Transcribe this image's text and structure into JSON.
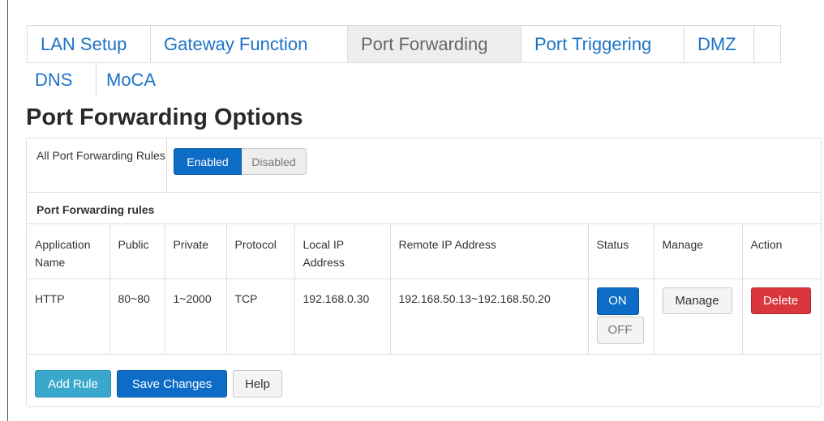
{
  "tabs": {
    "row1": [
      "LAN Setup",
      "Gateway Function",
      "Port Forwarding",
      "Port Triggering",
      "DMZ"
    ],
    "row2": [
      "DNS",
      "MoCA"
    ],
    "active": "Port Forwarding"
  },
  "page_title": "Port Forwarding Options",
  "options": {
    "all_rules_label": "All Port Forwarding Rules",
    "enabled_label": "Enabled",
    "disabled_label": "Disabled",
    "selected": "Enabled"
  },
  "rules_section": {
    "title": "Port Forwarding rules",
    "columns": [
      "Application Name",
      "Public",
      "Private",
      "Protocol",
      "Local IP Address",
      "Remote IP Address",
      "Status",
      "Manage",
      "Action"
    ],
    "rows": [
      {
        "application_name": "HTTP",
        "public": "80~80",
        "private": "1~2000",
        "protocol": "TCP",
        "local_ip": "192.168.0.30",
        "remote_ip": "192.168.50.13~192.168.50.20",
        "status_on": "ON",
        "status_off": "OFF",
        "status_selected": "ON",
        "manage_label": "Manage",
        "delete_label": "Delete"
      }
    ]
  },
  "footer": {
    "add_rule": "Add Rule",
    "save_changes": "Save Changes",
    "help": "Help"
  },
  "colors": {
    "link_blue": "#1d73c5",
    "primary_blue": "#0d6cc6",
    "info_teal": "#3aa8cc",
    "danger_red": "#d9363e"
  }
}
